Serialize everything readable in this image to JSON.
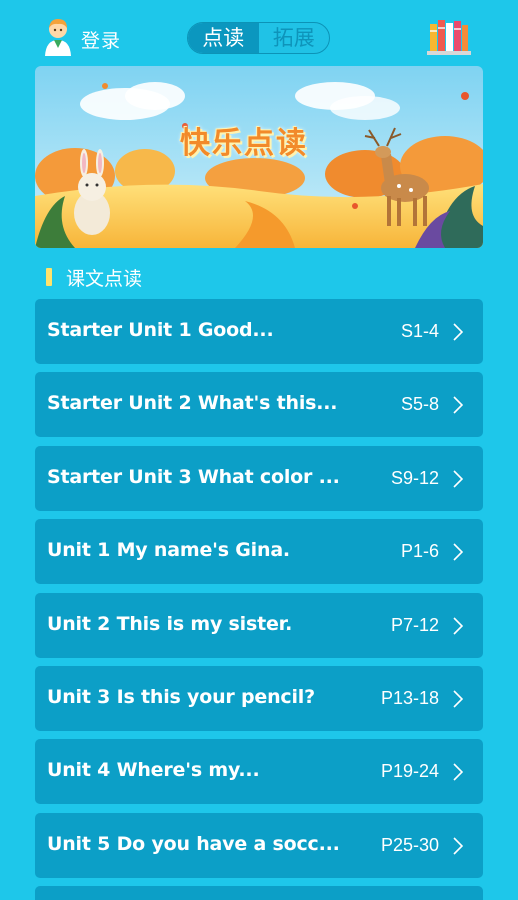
{
  "header": {
    "login_label": "登录",
    "tabs": [
      {
        "label": "点读",
        "active": true
      },
      {
        "label": "拓展",
        "active": false
      }
    ],
    "icons": [
      "avatar-icon",
      "bookshelf-icon"
    ]
  },
  "banner": {
    "title": "快乐点读"
  },
  "section": {
    "title": "课文点读"
  },
  "units": [
    {
      "title": "Starter Unit 1 Good...",
      "pages": "S1-4"
    },
    {
      "title": "Starter Unit 2 What's this...",
      "pages": "S5-8"
    },
    {
      "title": "Starter Unit 3 What color ...",
      "pages": "S9-12"
    },
    {
      "title": "Unit 1 My name's Gina.",
      "pages": "P1-6"
    },
    {
      "title": "Unit 2 This is my sister.",
      "pages": "P7-12"
    },
    {
      "title": "Unit 3 Is this your pencil?",
      "pages": "P13-18"
    },
    {
      "title": "Unit 4 Where's my...",
      "pages": "P19-24"
    },
    {
      "title": "Unit 5 Do you have a socc...",
      "pages": "P25-30"
    }
  ],
  "colors": {
    "background": "#1ec7ea",
    "row": "#0c9fc7",
    "accent": "#ffe36b"
  }
}
